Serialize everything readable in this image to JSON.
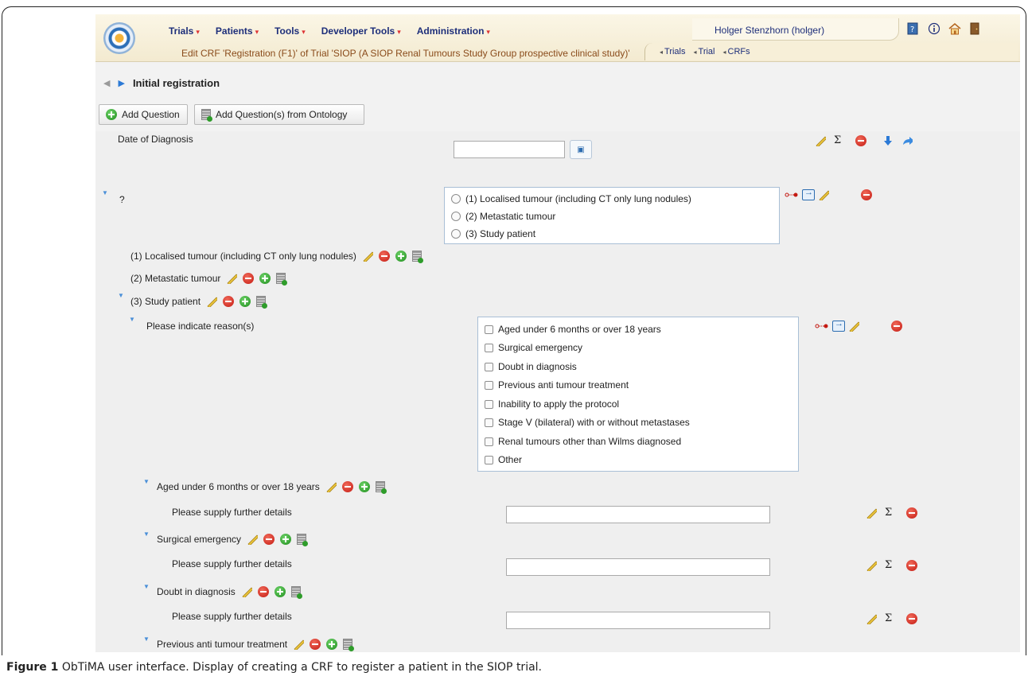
{
  "menu": {
    "items": [
      {
        "label": "Trials"
      },
      {
        "label": "Patients"
      },
      {
        "label": "Tools"
      },
      {
        "label": "Developer Tools"
      },
      {
        "label": "Administration"
      }
    ],
    "caret": "▾"
  },
  "header": {
    "subtitle": "Edit CRF 'Registration (F1)' of Trial 'SIOP (A SIOP Renal Tumours Study Group prospective clinical study)'",
    "user": "Holger Stenzhorn (holger)",
    "crumbs": [
      "Trials",
      "Trial",
      "CRFs"
    ],
    "crumb_marker": "◂"
  },
  "section": {
    "title": "Initial registration",
    "prev_arrow": "◀",
    "next_arrow": "▶"
  },
  "buttons": {
    "add_question": "Add Question",
    "add_from_ontology": "Add Question(s) from Ontology"
  },
  "form": {
    "expander": "▼",
    "sigma": "Σ",
    "date_label": "Date of Diagnosis",
    "calendar_glyph": "▣",
    "question_mark": "?",
    "radio_options": [
      "(1) Localised tumour (including CT only lung nodules)",
      "(2) Metastatic tumour",
      "(3) Study patient"
    ],
    "answer_nodes": [
      "(1) Localised tumour (including CT only lung nodules)",
      "(2) Metastatic tumour",
      "(3) Study patient"
    ],
    "reasons_label": "Please indicate reason(s)",
    "check_options": [
      "Aged under 6 months or over 18 years",
      "Surgical emergency",
      "Doubt in diagnosis",
      "Previous anti tumour treatment",
      "Inability to apply the protocol",
      "Stage V (bilateral) with or without metastases",
      "Renal tumours other than Wilms diagnosed",
      "Other"
    ],
    "sub_nodes": [
      "Aged under 6 months or over 18 years",
      "Surgical emergency",
      "Doubt in diagnosis",
      "Previous anti tumour treatment"
    ],
    "details_label": "Please supply further details"
  },
  "caption": {
    "bold": "Figure 1",
    "text": " ObTiMA user interface. Display of creating a CRF to register a patient in the SIOP trial."
  },
  "colors": {
    "menu_text": "#1d2e7a",
    "subtitle_text": "#8a4b1a",
    "delete_red": "#c41a12",
    "add_green": "#1f8c1c",
    "expander_blue": "#4a8fd8"
  }
}
